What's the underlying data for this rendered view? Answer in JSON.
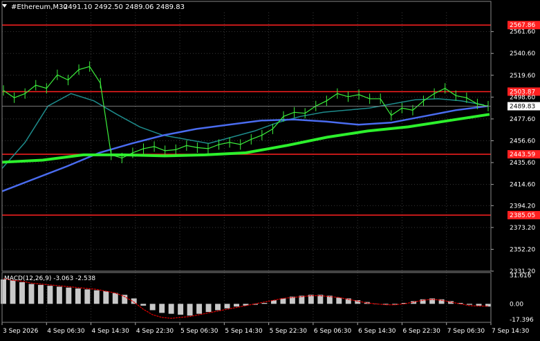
{
  "header": {
    "symbol_label": "#Ethereum,M30",
    "ohlc": "2491.10 2492.50 2489.06 2489.83",
    "menu_icon": "triangle-down-icon"
  },
  "colors": {
    "background": "#000000",
    "grid": "#3a3a3a",
    "axis_text": "#ffffff",
    "candle": "#3cf03c",
    "level_line": "#ff2020",
    "ma_fast": "#1e8c8c",
    "ma_mid": "#4a6cf0",
    "ma_slow": "#2cf02c",
    "macd_hist": "#c8c8c8",
    "macd_signal": "#e00000",
    "price_label_bg": "#ffffff",
    "price_label_text": "#000000"
  },
  "price_axis": [
    "2561.60",
    "2540.60",
    "2519.60",
    "2498.60",
    "2477.60",
    "2456.60",
    "2435.60",
    "2414.60",
    "2394.20",
    "2373.20",
    "2352.20",
    "2331.20"
  ],
  "current_price": "2489.83",
  "levels": [
    "2567.86",
    "2503.87",
    "2443.59",
    "2385.05"
  ],
  "time_axis": [
    "3 Sep 2026",
    "4 Sep 06:30",
    "4 Sep 14:30",
    "4 Sep 22:30",
    "5 Sep 06:30",
    "5 Sep 14:30",
    "5 Sep 22:30",
    "6 Sep 06:30",
    "6 Sep 14:30",
    "6 Sep 22:30",
    "7 Sep 06:30",
    "7 Sep 14:30"
  ],
  "macd": {
    "label": "MACD(12,26,9) -3.063 -2.538",
    "axis": [
      "31.616",
      "0.00",
      "-17.396"
    ]
  },
  "chart_data": {
    "type": "line",
    "title": "#Ethereum,M30",
    "x_labels": [
      "3 Sep 2026",
      "4 Sep 06:30",
      "4 Sep 14:30",
      "4 Sep 22:30",
      "5 Sep 06:30",
      "5 Sep 14:30",
      "5 Sep 22:30",
      "6 Sep 06:30",
      "6 Sep 14:30",
      "6 Sep 22:30",
      "7 Sep 06:30",
      "7 Sep 14:30"
    ],
    "ylim": [
      2331.2,
      2580
    ],
    "grid": true,
    "series": [
      {
        "values": [
          2505,
          2498,
          2502,
          2510,
          2507,
          2520,
          2515,
          2525,
          2528,
          2512,
          2443,
          2440,
          2445,
          2449,
          2451,
          2447,
          2448,
          2452,
          2450,
          2449,
          2453,
          2455,
          2453,
          2458,
          2462,
          2468,
          2480,
          2484,
          2483,
          2490,
          2495,
          2502,
          2499,
          2501,
          2497,
          2497,
          2481,
          2488,
          2486,
          2495,
          2502,
          2507,
          2500,
          2498,
          2492,
          2489.83
        ]
      },
      {
        "values": [
          2430,
          2455,
          2490,
          2502,
          2495,
          2482,
          2470,
          2462,
          2458,
          2454,
          2460,
          2466,
          2474,
          2480,
          2484,
          2486,
          2488,
          2492,
          2496,
          2497,
          2495,
          2491
        ]
      },
      {
        "values": [
          2408,
          2420,
          2432,
          2445,
          2454,
          2462,
          2468,
          2472,
          2476,
          2477,
          2475,
          2472,
          2474,
          2480,
          2486,
          2490
        ]
      },
      {
        "values": [
          2436,
          2438,
          2443,
          2443,
          2442,
          2443,
          2445,
          2452,
          2460,
          2466,
          2470,
          2476,
          2482
        ]
      }
    ],
    "macd": {
      "hist": [
        27,
        26,
        24,
        22,
        21,
        20,
        19,
        18,
        17,
        16,
        15,
        14,
        12,
        10,
        6,
        -2,
        -7,
        -10,
        -11,
        -12,
        -13,
        -11,
        -9,
        -7,
        -5,
        -3,
        -2,
        -1,
        1,
        4,
        6,
        8,
        9,
        10,
        10,
        9,
        7,
        6,
        4,
        2,
        0,
        -1,
        -1,
        1,
        3,
        5,
        6,
        5,
        3,
        1,
        -1,
        -2,
        -3
      ],
      "signal": [
        28,
        26,
        25,
        23,
        22,
        21,
        20,
        19,
        18,
        17,
        16,
        14,
        12,
        8,
        2,
        -6,
        -12,
        -15,
        -16,
        -15,
        -14,
        -12,
        -10,
        -8,
        -6,
        -4,
        -2,
        0,
        2,
        4,
        6,
        7,
        8,
        9,
        9,
        8,
        7,
        5,
        3,
        1,
        0,
        -1,
        -1,
        0,
        2,
        4,
        5,
        4,
        2,
        0,
        -2,
        -2.5,
        -2.5
      ]
    }
  }
}
